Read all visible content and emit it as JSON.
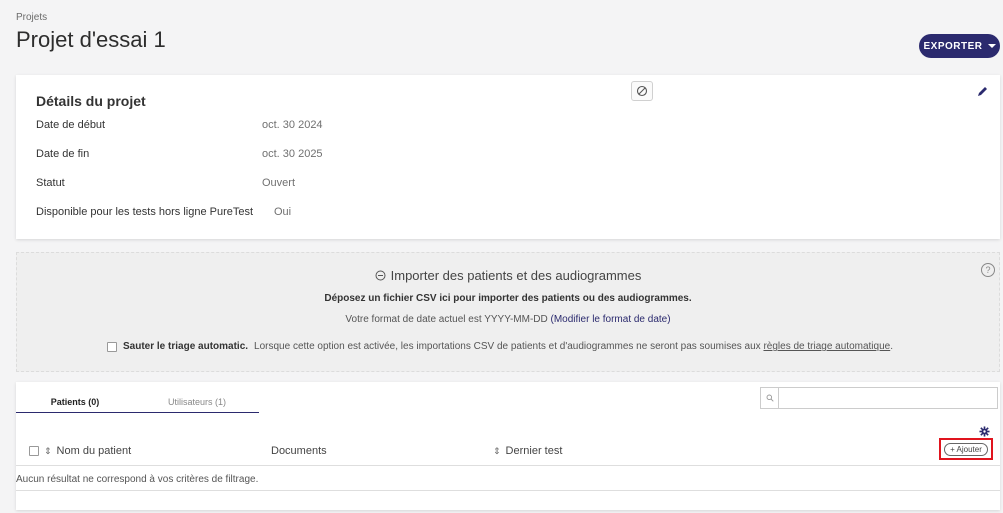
{
  "breadcrumb": "Projets",
  "page_title": "Projet d'essai 1",
  "export_label": "EXPORTER",
  "details": {
    "title": "Détails du projet",
    "rows": [
      {
        "label": "Date de début",
        "value": "oct. 30 2024"
      },
      {
        "label": "Date de fin",
        "value": "oct. 30 2025"
      },
      {
        "label": "Statut",
        "value": "Ouvert"
      },
      {
        "label": "Disponible pour les tests hors ligne PureTest",
        "value": "Oui"
      }
    ]
  },
  "import": {
    "title": "Importer des patients et des audiogrammes",
    "drop_text": "Déposez un fichier CSV ici pour importer des patients ou des audiogrammes.",
    "date_format_text": "Votre format de date actuel est YYYY-MM-DD",
    "date_format_link": "(Modifier le format de date)",
    "triage_label": "Sauter le triage automatic.",
    "triage_desc": "Lorsque cette option est activée, les importations CSV de patients et d'audiogrammes ne seront pas soumises aux",
    "triage_link": "règles de triage automatique",
    "triage_end": "."
  },
  "tabs": [
    {
      "label": "Patients (0)",
      "active": true
    },
    {
      "label": "Utilisateurs (1)",
      "active": false
    }
  ],
  "search": {
    "placeholder": ""
  },
  "table": {
    "columns": [
      "Nom du patient",
      "Documents",
      "Dernier test"
    ],
    "add_label": "+ Ajouter",
    "empty_message": "Aucun résultat ne correspond à vos critères de filtrage."
  },
  "colors": {
    "accent": "#2b2a6e",
    "highlight": "#e0141e"
  }
}
